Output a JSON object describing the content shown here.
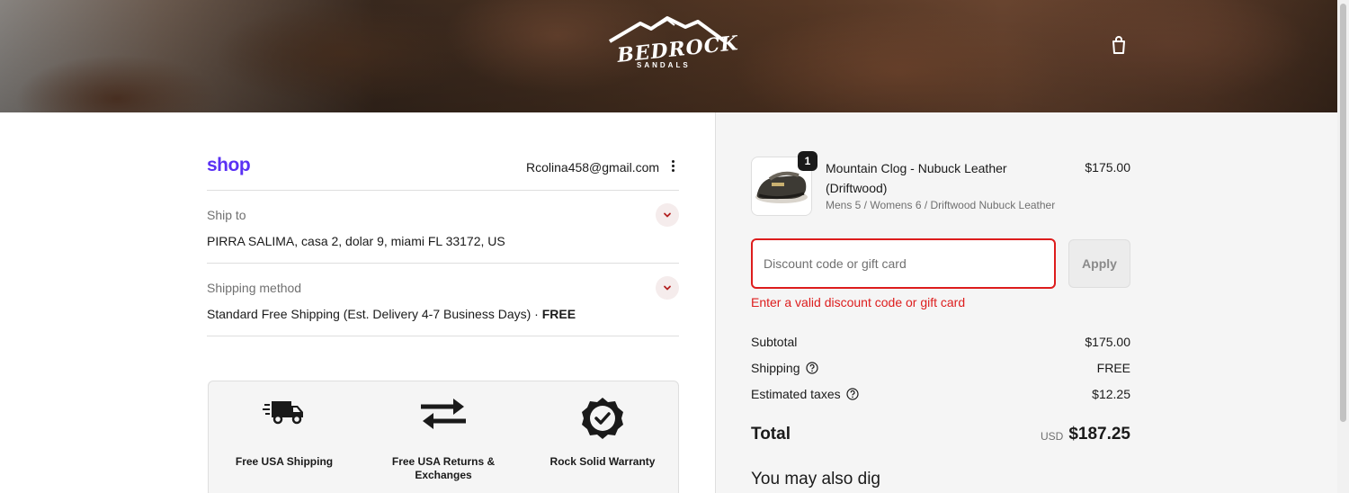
{
  "header": {
    "brand_name": "BEDROCK",
    "brand_sub": "SANDALS",
    "cart_icon": "shopping-bag-icon"
  },
  "account": {
    "shop_logo": "shop",
    "email": "Rcolina458@gmail.com",
    "menu_icon": "kebab-menu-icon"
  },
  "ship_to": {
    "label": "Ship to",
    "value": "PIRRA SALIMA, casa 2, dolar 9, miami FL 33172, US"
  },
  "shipping_method": {
    "label": "Shipping method",
    "value": "Standard Free Shipping (Est. Delivery 4-7 Business Days) · ",
    "price": "FREE"
  },
  "features": [
    {
      "icon": "delivery-truck-icon",
      "label": "Free USA Shipping"
    },
    {
      "icon": "exchange-arrows-icon",
      "label": "Free USA Returns & Exchanges"
    },
    {
      "icon": "warranty-badge-icon",
      "label": "Rock Solid Warranty"
    }
  ],
  "cart_item": {
    "quantity": "1",
    "name": "Mountain Clog - Nubuck Leather (Driftwood)",
    "variant": "Mens 5 / Womens 6 / Driftwood Nubuck Leather",
    "price": "$175.00"
  },
  "discount": {
    "placeholder": "Discount code or gift card",
    "apply_label": "Apply",
    "error": "Enter a valid discount code or gift card"
  },
  "summary": {
    "subtotal_label": "Subtotal",
    "subtotal_value": "$175.00",
    "shipping_label": "Shipping",
    "shipping_value": "FREE",
    "taxes_label": "Estimated taxes",
    "taxes_value": "$12.25",
    "total_label": "Total",
    "total_currency": "USD",
    "total_value": "$187.25"
  },
  "recommendations": {
    "heading": "You may also dig"
  },
  "colors": {
    "accent_shop": "#5a31f4",
    "error": "#dd1d1d",
    "panel_bg": "#f5f5f5"
  }
}
